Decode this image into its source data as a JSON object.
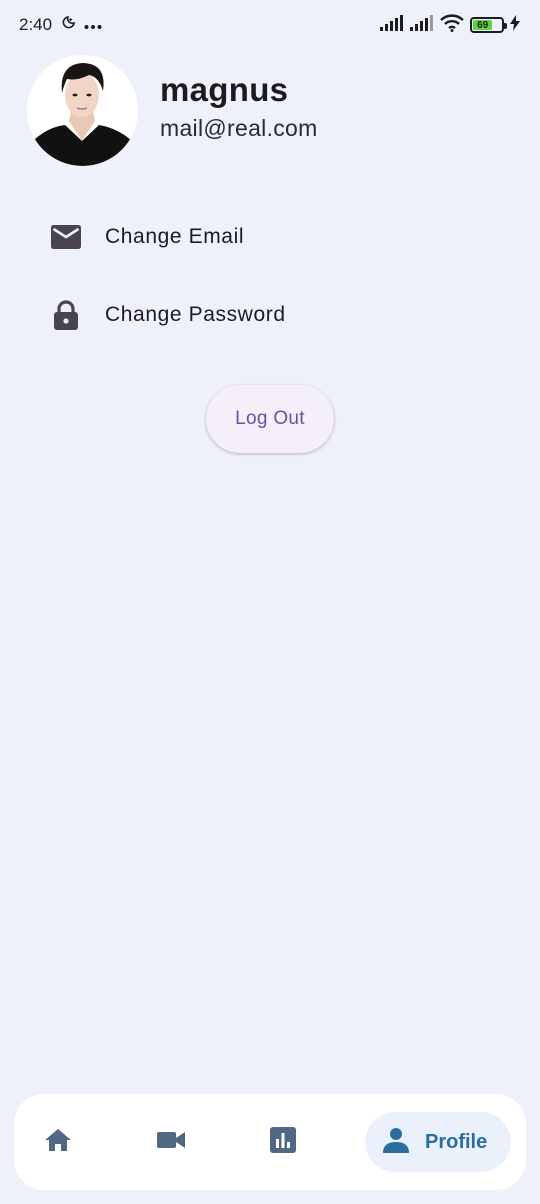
{
  "status_bar": {
    "time": "2:40",
    "battery_level": "69"
  },
  "profile": {
    "username": "magnus",
    "email": "mail@real.com"
  },
  "menu": {
    "items": [
      {
        "label": "Change Email",
        "icon": "mail-icon"
      },
      {
        "label": "Change Password",
        "icon": "lock-icon"
      }
    ]
  },
  "logout": {
    "label": "Log Out"
  },
  "bottom_nav": {
    "items": [
      {
        "icon": "home-icon",
        "label": ""
      },
      {
        "icon": "video-camera-icon",
        "label": ""
      },
      {
        "icon": "bar-chart-icon",
        "label": ""
      },
      {
        "icon": "person-icon",
        "label": "Profile",
        "active": true
      }
    ]
  },
  "colors": {
    "background": "#eef1f9",
    "accent": "#2b6e9e",
    "logout_text": "#6750a4",
    "nav_icon": "#4f6884"
  }
}
